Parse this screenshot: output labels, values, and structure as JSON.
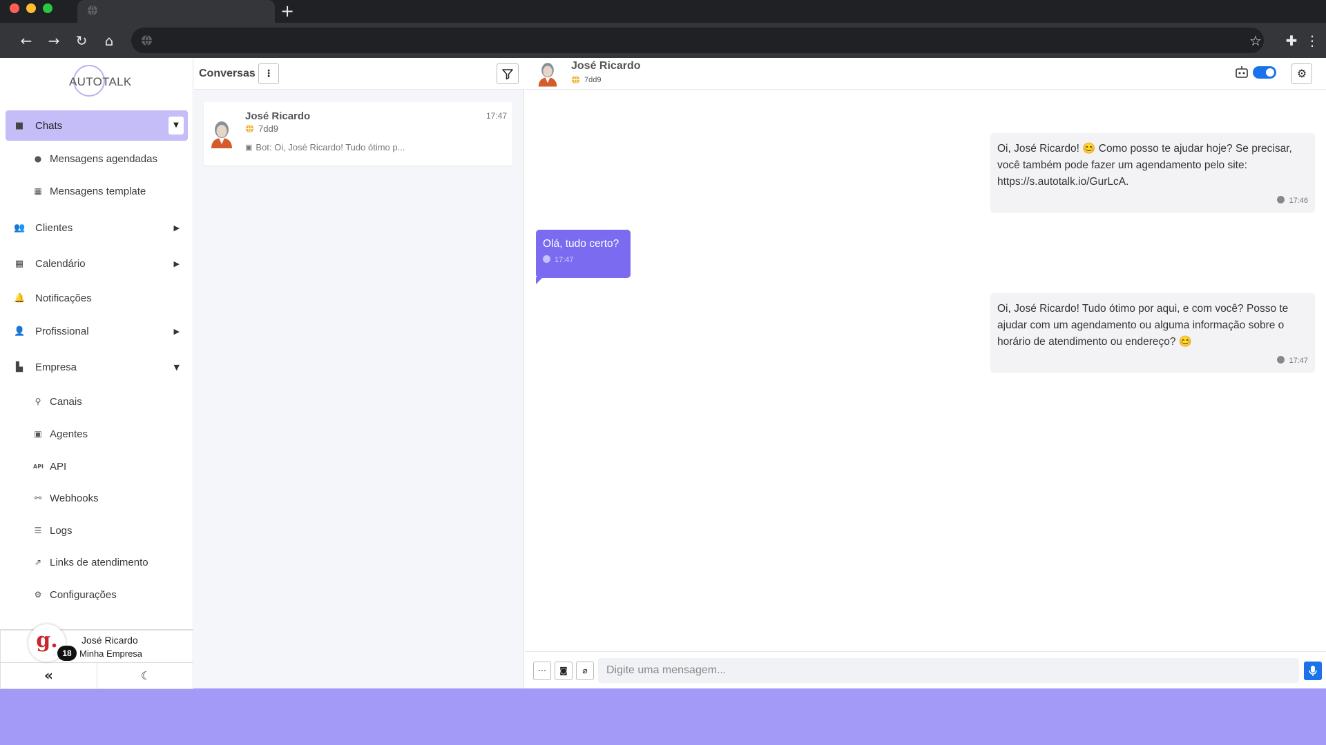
{
  "browser": {
    "new_tab": "+"
  },
  "sidebar": {
    "logo": "AUTOTALK",
    "items": [
      {
        "label": "Chats"
      },
      {
        "label": "Mensagens agendadas"
      },
      {
        "label": "Mensagens template"
      },
      {
        "label": "Clientes"
      },
      {
        "label": "Calendário"
      },
      {
        "label": "Notificações"
      },
      {
        "label": "Profissional"
      },
      {
        "label": "Empresa"
      },
      {
        "label": "Canais"
      },
      {
        "label": "Agentes"
      },
      {
        "label": "API"
      },
      {
        "label": "Webhooks"
      },
      {
        "label": "Logs"
      },
      {
        "label": "Links de atendimento"
      },
      {
        "label": "Configurações"
      }
    ],
    "user": {
      "initial": "g.",
      "badge": "18",
      "name": "José Ricardo",
      "company": "Minha Empresa"
    }
  },
  "conversations": {
    "title": "Conversas",
    "items": [
      {
        "name": "José Ricardo",
        "time": "17:47",
        "tag": "7dd9",
        "preview": "Bot: Oi, José Ricardo! Tudo ótimo p..."
      }
    ]
  },
  "chat": {
    "contact_name": "José Ricardo",
    "contact_tag": "7dd9",
    "messages": [
      {
        "direction": "out",
        "text": "Oi, José Ricardo! 😊 Como posso te ajudar hoje? Se precisar, você também pode fazer um agendamento pelo site: https://s.autotalk.io/GurLcA.",
        "time": "17:46"
      },
      {
        "direction": "in",
        "text": "Olá, tudo certo?",
        "time": "17:47"
      },
      {
        "direction": "out",
        "text": "Oi, José Ricardo! Tudo ótimo por aqui, e com você? Posso te ajudar com um agendamento ou alguma informação sobre o horário de atendimento ou endereço? 😊",
        "time": "17:47"
      }
    ],
    "composer_placeholder": "Digite uma mensagem..."
  },
  "colors": {
    "accent": "#7b6bf0",
    "active_nav": "#c4bdf7",
    "toggle": "#1a73e8",
    "background": "#a39af7"
  }
}
